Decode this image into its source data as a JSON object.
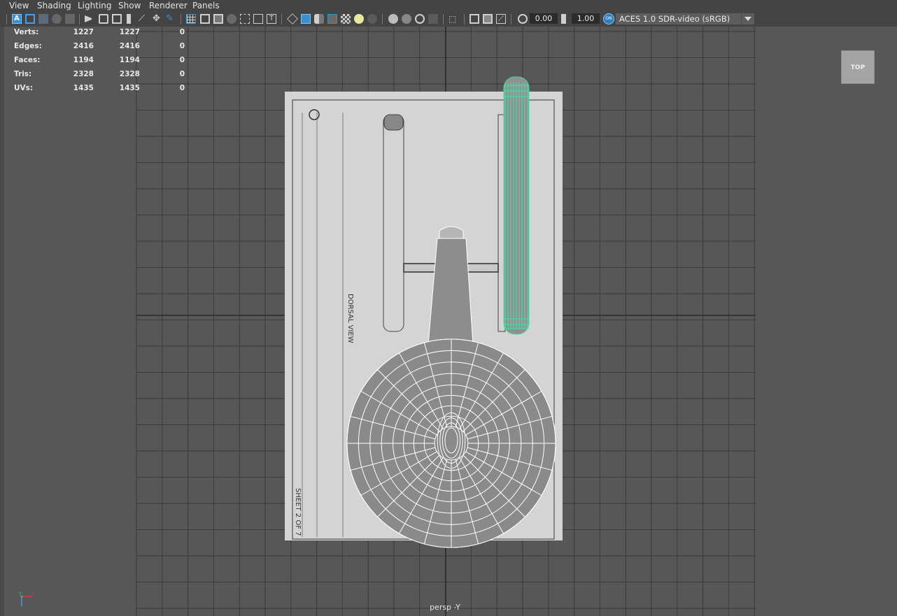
{
  "menu": [
    {
      "id": "view",
      "label": "View"
    },
    {
      "id": "shading",
      "label": "Shading"
    },
    {
      "id": "lighting",
      "label": "Lighting"
    },
    {
      "id": "show",
      "label": "Show"
    },
    {
      "id": "renderer",
      "label": "Renderer"
    },
    {
      "id": "panels",
      "label": "Panels"
    }
  ],
  "toolbar": {
    "exposure_value": "0.00",
    "gamma_value": "1.00",
    "color_management_label": "ACES 1.0 SDR-video (sRGB)",
    "active_color": "#3a8fd0",
    "cm_toggle_color": "#2f7fc0"
  },
  "hud": {
    "rows": [
      {
        "label": "Verts:",
        "v1": "1227",
        "v2": "1227",
        "v3": "0"
      },
      {
        "label": "Edges:",
        "v1": "2416",
        "v2": "2416",
        "v3": "0"
      },
      {
        "label": "Faces:",
        "v1": "1194",
        "v2": "1194",
        "v3": "0"
      },
      {
        "label": "Tris:",
        "v1": "2328",
        "v2": "2328",
        "v3": "0"
      },
      {
        "label": "UVs:",
        "v1": "1435",
        "v2": "1435",
        "v3": "0"
      }
    ]
  },
  "viewcube": {
    "label": "TOP"
  },
  "camera": {
    "label": "persp -Y"
  },
  "blueprint": {
    "title": "DORSAL VIEW",
    "sheet": "SHEET 2 OF 7"
  },
  "axes": {
    "x_label": "x",
    "y_label": "y",
    "x_color": "#d83a3a",
    "y_color": "#4a8cff",
    "z_color": "#44c060"
  },
  "colors": {
    "viewport_bg": "#575757",
    "grid": "#3a3a3a",
    "selection": "#41e3a8",
    "blueprint_paper": "#d4d4d4"
  }
}
